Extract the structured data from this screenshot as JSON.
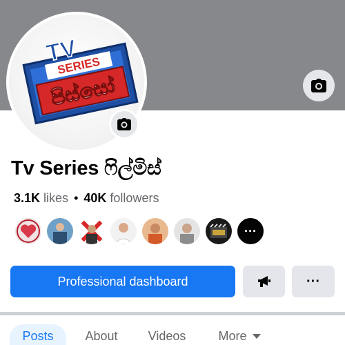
{
  "page": {
    "name": "Tv Series ෆිල්මිස්",
    "logo_text": "TV SERIES පිස්සෝ"
  },
  "stats": {
    "likes_value": "3.1K",
    "likes_label": "likes",
    "separator": "•",
    "followers_value": "40K",
    "followers_label": "followers"
  },
  "friends": {
    "more_label": "···"
  },
  "actions": {
    "primary_label": "Professional dashboard",
    "more_label": "···"
  },
  "tabs": [
    {
      "label": "Posts",
      "active": true
    },
    {
      "label": "About",
      "active": false
    },
    {
      "label": "Videos",
      "active": false
    },
    {
      "label": "More",
      "active": false
    }
  ],
  "colors": {
    "cover": "#86888c",
    "primary": "#1877f2",
    "button_grey": "#e4e6eb",
    "active_tab_bg": "#e7f3ff"
  }
}
